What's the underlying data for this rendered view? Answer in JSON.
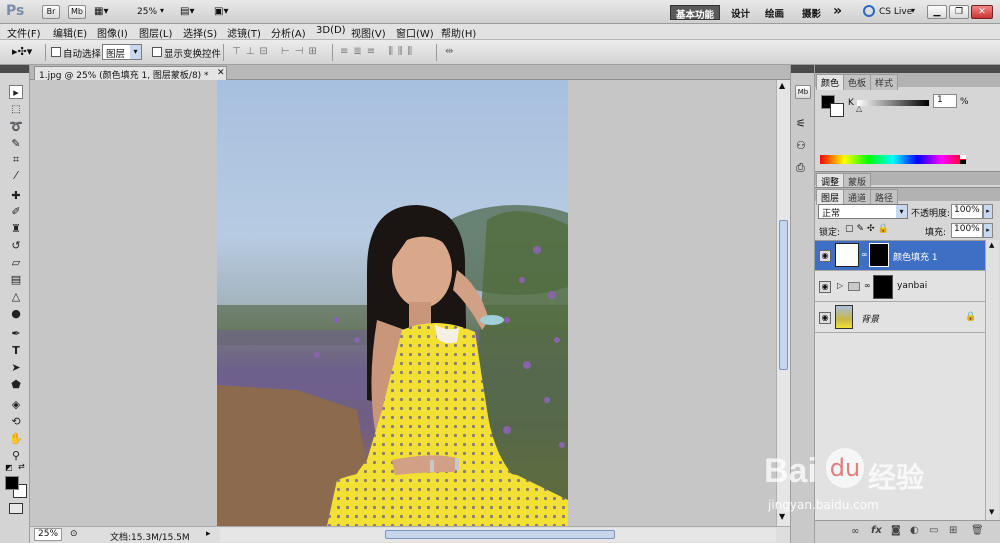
{
  "app": {
    "logo": "Ps",
    "bridge_btn": "Br",
    "minibridge_btn": "Mb",
    "zoom": "25%",
    "workspaces": [
      "基本功能",
      "设计",
      "绘画",
      "摄影"
    ],
    "more": "»",
    "cslive": "CS Live"
  },
  "menu": [
    "文件(F)",
    "编辑(E)",
    "图像(I)",
    "图层(L)",
    "选择(S)",
    "滤镜(T)",
    "分析(A)",
    "3D(D)",
    "视图(V)",
    "窗口(W)",
    "帮助(H)"
  ],
  "options": {
    "auto_select_label": "自动选择:",
    "auto_select_value": "图层",
    "show_transform_label": "显示变换控件"
  },
  "document": {
    "tab_title": "1.jpg @ 25% (颜色填充 1, 图层蒙板/8) *",
    "zoom": "25%",
    "doc_size": "文档:15.3M/15.5M"
  },
  "panels": {
    "color_tabs": [
      "颜色",
      "色板",
      "样式"
    ],
    "channel": "K",
    "k_value": "1",
    "k_unit": "%",
    "adjust_tabs": [
      "调整",
      "蒙版"
    ],
    "layer_tabs": [
      "图层",
      "通道",
      "路径"
    ],
    "blend_mode": "正常",
    "opacity_label": "不透明度:",
    "opacity": "100%",
    "lock_label": "锁定:",
    "fill_label": "填充:",
    "fill": "100%",
    "layers": [
      {
        "name": "颜色填充 1",
        "selected": true
      },
      {
        "name": "yanbai",
        "selected": false
      },
      {
        "name": "背景",
        "selected": false
      }
    ]
  },
  "watermark": {
    "brand": "Bai",
    "brand2": "经验",
    "url": "jingyan.baidu.com"
  },
  "colors": {
    "selected_layer": "#3d6fc4",
    "dress": "#f2e134",
    "sky": "#a9c2e0"
  }
}
